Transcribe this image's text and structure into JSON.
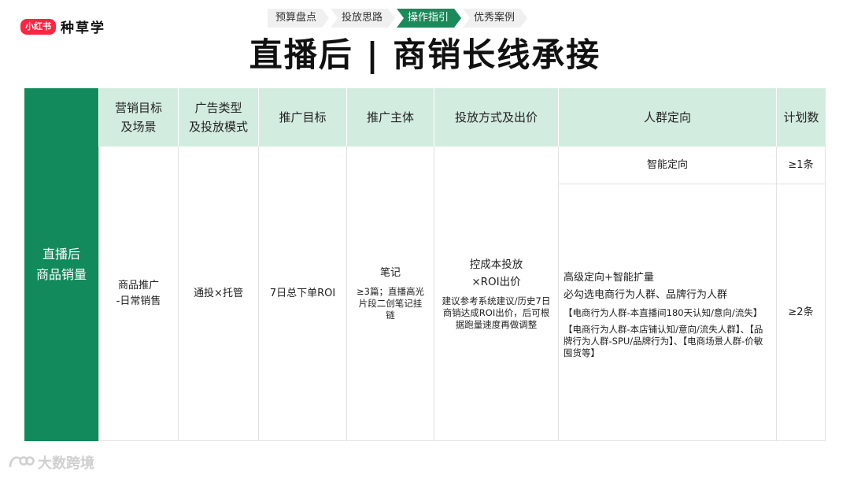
{
  "brand": {
    "badge": "小红书",
    "name": "种草学"
  },
  "steps": [
    {
      "label": "预算盘点",
      "active": false
    },
    {
      "label": "投放思路",
      "active": false
    },
    {
      "label": "操作指引",
      "active": true
    },
    {
      "label": "优秀案例",
      "active": false
    }
  ],
  "title": "直播后 | 商销长线承接",
  "table": {
    "side_label": [
      "直播后",
      "商品销量"
    ],
    "headers": {
      "goal": [
        "营销目标",
        "及场景"
      ],
      "ad_type": [
        "广告类型",
        "及投放模式"
      ],
      "promo_target": "推广目标",
      "subject": "推广主体",
      "bid": "投放方式及出价",
      "crowd": "人群定向",
      "plan_count": "计划数"
    },
    "row": {
      "goal": [
        "商品推广",
        "-日常销售"
      ],
      "ad_type": "通投×托管",
      "promo_target": "7日总下单ROI",
      "subject_main": "笔记",
      "subject_note": "≥3篇；直播高光片段二创笔记挂链",
      "bid_main": [
        "控成本投放",
        "×ROI出价"
      ],
      "bid_note": "建议参考系统建议/历史7日商销达成ROI出价，后可根据跑量速度再做调整",
      "crowd_smart": "智能定向",
      "count_smart": "≥1条",
      "crowd_adv_1": "高级定向+智能扩量",
      "crowd_adv_2": "必勾选电商行为人群、品牌行为人群",
      "crowd_adv_3": "【电商行为人群-本直播间180天认知/意向/流失】",
      "crowd_adv_4": "【电商行为人群-本店铺认知/意向/流失人群】、【品牌行为人群-SPU/品牌行为】、【电商场景人群-价敏囤货等】",
      "count_adv": "≥2条"
    }
  },
  "watermark": "大数跨境"
}
